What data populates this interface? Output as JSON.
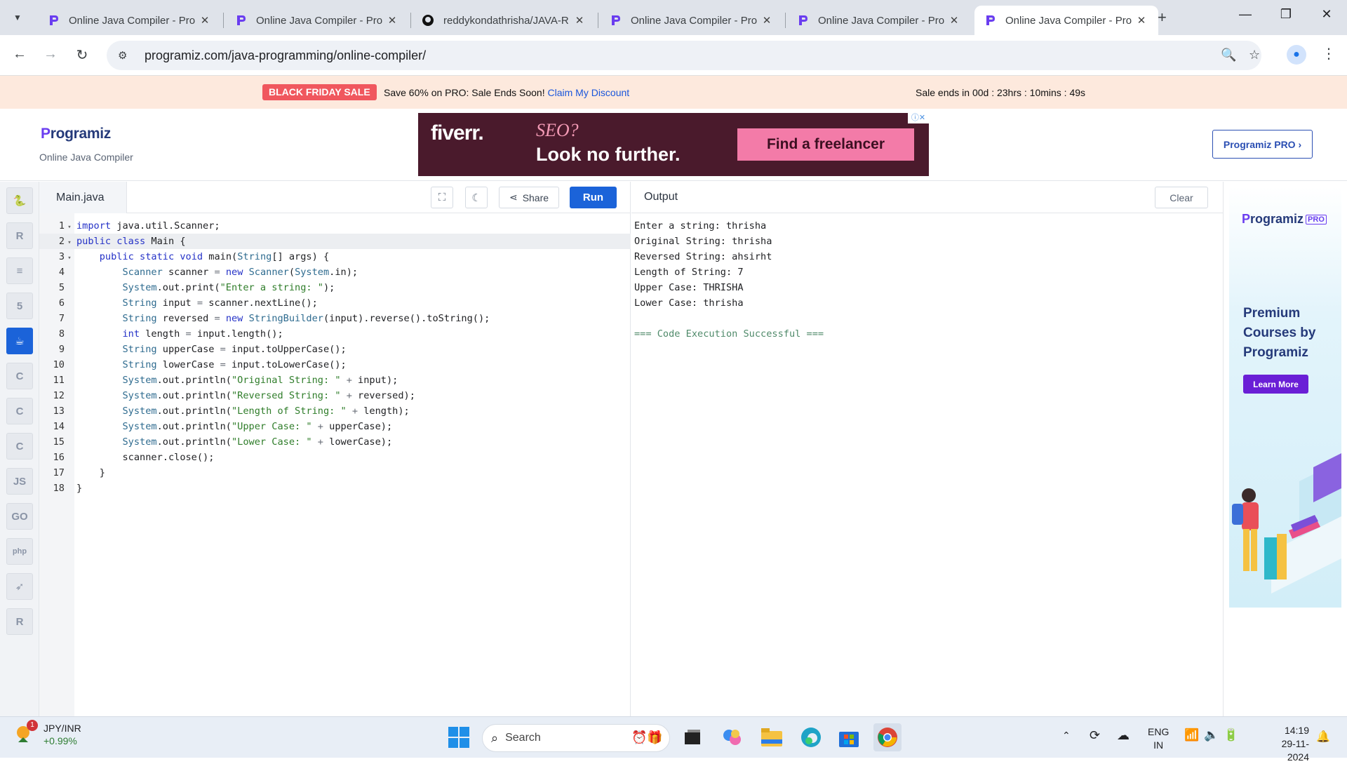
{
  "browser": {
    "tabs": [
      {
        "title": "Online Java Compiler - Pro",
        "favicon": "programiz-icon",
        "active": false
      },
      {
        "title": "Online Java Compiler - Pro",
        "favicon": "programiz-icon",
        "active": false
      },
      {
        "title": "reddykondathrisha/JAVA-R",
        "favicon": "github-icon",
        "active": false
      },
      {
        "title": "Online Java Compiler - Pro",
        "favicon": "programiz-icon",
        "active": false
      },
      {
        "title": "Online Java Compiler - Pro",
        "favicon": "programiz-icon",
        "active": false
      },
      {
        "title": "Online Java Compiler - Pro",
        "favicon": "programiz-icon",
        "active": true
      }
    ],
    "url": "programiz.com/java-programming/online-compiler/"
  },
  "promo": {
    "badge": "BLACK FRIDAY SALE",
    "message": "Save 60% on PRO: Sale Ends Soon!",
    "link": "Claim My Discount",
    "timer": "Sale ends in 00d : 23hrs : 10mins : 49s",
    "accent": "#f0575e"
  },
  "header": {
    "logo": "rogramiz",
    "logo_initial": "P",
    "subtitle": "Online Java Compiler",
    "pro_button": "Programiz PRO ›"
  },
  "top_ad": {
    "brand": "fiverr.",
    "line1": "SEO?",
    "line2": "Look no further.",
    "cta": "Find a freelancer"
  },
  "sidebar": {
    "languages": [
      {
        "name": "python",
        "glyph": "🐍",
        "active": false
      },
      {
        "name": "r",
        "glyph": "R",
        "active": false
      },
      {
        "name": "sql",
        "glyph": "≡",
        "active": false
      },
      {
        "name": "html",
        "glyph": "5",
        "active": false
      },
      {
        "name": "java",
        "glyph": "☕",
        "active": true
      },
      {
        "name": "c",
        "glyph": "C",
        "active": false
      },
      {
        "name": "cpp",
        "glyph": "C",
        "active": false
      },
      {
        "name": "csharp",
        "glyph": "C",
        "active": false
      },
      {
        "name": "javascript",
        "glyph": "JS",
        "active": false
      },
      {
        "name": "go",
        "glyph": "GO",
        "active": false
      },
      {
        "name": "php",
        "glyph": "php",
        "active": false
      },
      {
        "name": "swift",
        "glyph": "➶",
        "active": false
      },
      {
        "name": "rust",
        "glyph": "R",
        "active": false
      }
    ]
  },
  "editor": {
    "filename": "Main.java",
    "share_label": "Share",
    "run_label": "Run",
    "accent": "#1b63d9",
    "lines": [
      "import java.util.Scanner;",
      "public class Main {",
      "    public static void main(String[] args) {",
      "        Scanner scanner = new Scanner(System.in);",
      "        System.out.print(\"Enter a string: \");",
      "        String input = scanner.nextLine();",
      "        String reversed = new StringBuilder(input).reverse().toString();",
      "        int length = input.length();",
      "        String upperCase = input.toUpperCase();",
      "        String lowerCase = input.toLowerCase();",
      "        System.out.println(\"Original String: \" + input);",
      "        System.out.println(\"Reversed String: \" + reversed);",
      "        System.out.println(\"Length of String: \" + length);",
      "        System.out.println(\"Upper Case: \" + upperCase);",
      "        System.out.println(\"Lower Case: \" + lowerCase);",
      "        scanner.close();",
      "    }",
      "}"
    ]
  },
  "output": {
    "title": "Output",
    "clear_label": "Clear",
    "lines": [
      "Enter a string: thrisha",
      "Original String: thrisha",
      "Reversed String: ahsirht",
      "Length of String: 7",
      "Upper Case: THRISHA",
      "Lower Case: thrisha",
      "",
      "=== Code Execution Successful ==="
    ]
  },
  "side_ad": {
    "logo": "rogramiz",
    "logo_initial": "P",
    "badge": "PRO",
    "headline": "Premium Courses by Programiz",
    "cta": "Learn More"
  },
  "taskbar": {
    "ticker_name": "JPY/INR",
    "ticker_change": "+0.99%",
    "notification_count": "1",
    "search_label": "Search",
    "lang_top": "ENG",
    "lang_bottom": "IN",
    "time": "14:19",
    "date": "29-11-2024"
  }
}
